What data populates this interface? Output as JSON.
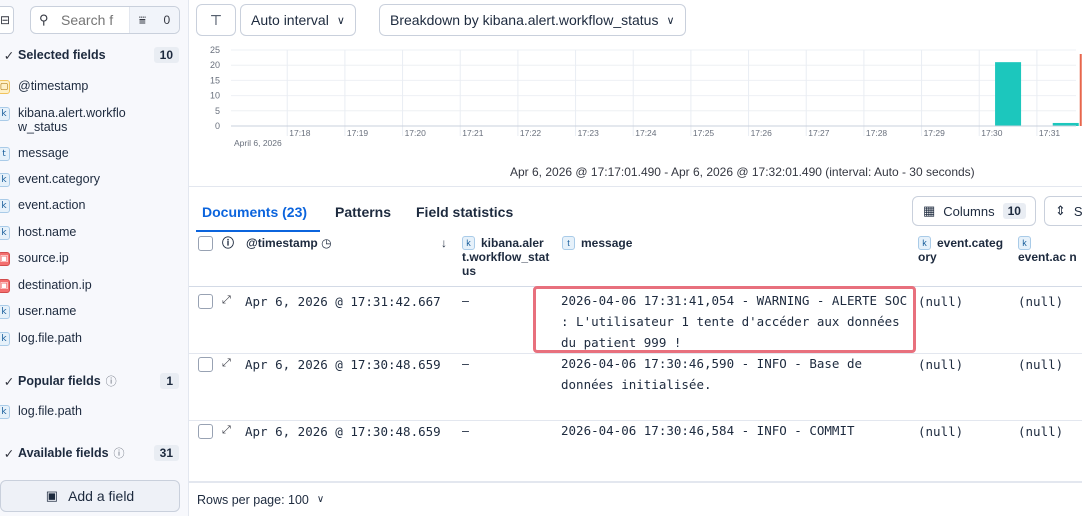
{
  "sidebar": {
    "search_placeholder": "Search f",
    "filter_count": "0",
    "selected": {
      "label": "Selected fields",
      "count": "10"
    },
    "selected_fields": [
      {
        "type": "d",
        "type_glyph": "▢",
        "name": "@timestamp"
      },
      {
        "type": "k",
        "type_glyph": "k",
        "name": "kibana.alert.workflo w_status"
      },
      {
        "type": "t",
        "type_glyph": "t",
        "name": "message"
      },
      {
        "type": "k",
        "type_glyph": "k",
        "name": "event.category"
      },
      {
        "type": "k",
        "type_glyph": "k",
        "name": "event.action"
      },
      {
        "type": "k",
        "type_glyph": "k",
        "name": "host.name"
      },
      {
        "type": "ip",
        "type_glyph": "▣",
        "name": "source.ip"
      },
      {
        "type": "ip",
        "type_glyph": "▣",
        "name": "destination.ip"
      },
      {
        "type": "k",
        "type_glyph": "k",
        "name": "user.name"
      },
      {
        "type": "k",
        "type_glyph": "k",
        "name": "log.file.path"
      }
    ],
    "popular": {
      "label": "Popular fields",
      "count": "1"
    },
    "popular_fields": [
      {
        "type": "k",
        "type_glyph": "k",
        "name": "log.file.path"
      }
    ],
    "available": {
      "label": "Available fields",
      "count": "31"
    },
    "add_field_label": "Add a field"
  },
  "toolbar": {
    "interval_label": "Auto interval",
    "breakdown_label": "Breakdown by kibana.alert.workflow_status"
  },
  "chart_data": {
    "type": "bar",
    "y_ticks": [
      "25",
      "20",
      "15",
      "10",
      "5",
      "0"
    ],
    "ylim": [
      0,
      25
    ],
    "x_ticks": [
      "17:18",
      "17:19",
      "17:20",
      "17:21",
      "17:22",
      "17:23",
      "17:24",
      "17:25",
      "17:26",
      "17:27",
      "17:28",
      "17:29",
      "17:30",
      "17:31"
    ],
    "x_sublabel": "April 6, 2026",
    "series": [
      {
        "color": "#1cc7bd",
        "points": [
          {
            "x": "17:30:30",
            "y": 21
          },
          {
            "x": "17:31:30",
            "y": 1
          }
        ]
      },
      {
        "color": "#e7664c",
        "points": [
          {
            "x": "17:31:30",
            "y": 0
          }
        ]
      }
    ],
    "interval_text": "Apr 6, 2026 @ 17:17:01.490 - Apr 6, 2026 @ 17:32:01.490 (interval: Auto - 30 seconds)"
  },
  "tabs": {
    "documents": "Documents (23)",
    "patterns": "Patterns",
    "field_statistics": "Field statistics"
  },
  "columns_button": {
    "label": "Columns",
    "count": "10"
  },
  "sort_button": {
    "label": "S"
  },
  "table": {
    "headers": {
      "timestamp": "@timestamp",
      "workflow": "kibana.aler t.workflow_stat us",
      "message": "message",
      "category": "event.categ ory",
      "action": "event.ac n"
    },
    "rows": [
      {
        "timestamp": "Apr 6, 2026 @ 17:31:42.667",
        "workflow": "–",
        "message": "2026-04-06 17:31:41,054 - WARNING - ALERTE SOC : L'utilisateur 1 tente d'accéder aux données du patient 999 !",
        "category": "(null)",
        "action": "(null)"
      },
      {
        "timestamp": "Apr 6, 2026 @ 17:30:48.659",
        "workflow": "–",
        "message": "2026-04-06 17:30:46,590 - INFO - Base de données initialisée.",
        "category": "(null)",
        "action": "(null)"
      },
      {
        "timestamp": "Apr 6, 2026 @ 17:30:48.659",
        "workflow": "–",
        "message": "2026-04-06 17:30:46,584 - INFO - COMMIT",
        "category": "(null)",
        "action": "(null)"
      }
    ]
  },
  "footer": {
    "rows_per_page": "Rows per page: 100"
  }
}
